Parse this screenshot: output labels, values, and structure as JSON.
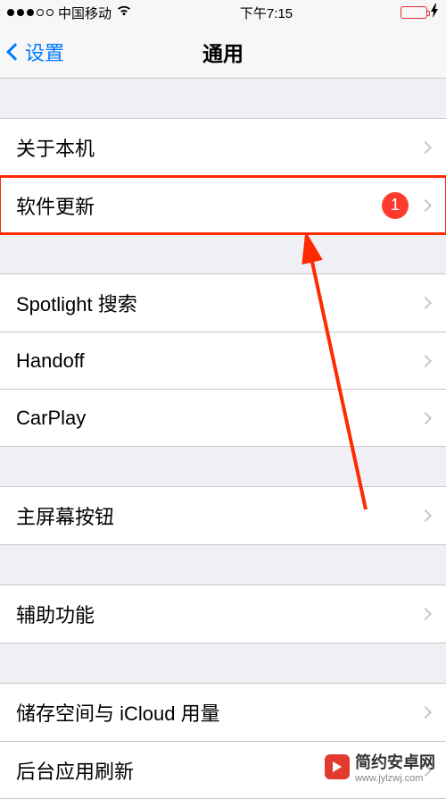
{
  "status": {
    "carrier": "中国移动",
    "time": "下午7:15"
  },
  "nav": {
    "back_label": "设置",
    "title": "通用"
  },
  "groups": [
    {
      "rows": [
        {
          "label": "关于本机",
          "badge": null
        },
        {
          "label": "软件更新",
          "badge": "1",
          "highlight": true
        }
      ]
    },
    {
      "rows": [
        {
          "label": "Spotlight 搜索",
          "badge": null
        },
        {
          "label": "Handoff",
          "badge": null
        },
        {
          "label": "CarPlay",
          "badge": null
        }
      ]
    },
    {
      "rows": [
        {
          "label": "主屏幕按钮",
          "badge": null
        }
      ]
    },
    {
      "rows": [
        {
          "label": "辅助功能",
          "badge": null
        }
      ]
    },
    {
      "rows": [
        {
          "label": "储存空间与 iCloud 用量",
          "badge": null
        },
        {
          "label": "后台应用刷新",
          "badge": null
        }
      ]
    }
  ],
  "watermark": {
    "text": "简约安卓网",
    "url": "www.jylzwj.com"
  },
  "annotation": {
    "highlight_color": "#ff2a00",
    "arrow_color": "#ff2a00"
  }
}
